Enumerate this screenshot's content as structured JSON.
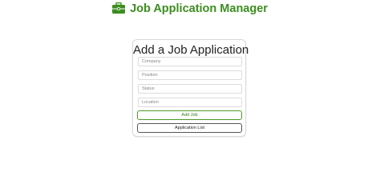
{
  "header": {
    "title": "Job Application Manager",
    "icon": "briefcase-icon",
    "accent_color": "#3c8e1f"
  },
  "form": {
    "title": "Add a Job Application",
    "fields": {
      "company": {
        "placeholder": "Company",
        "value": ""
      },
      "position": {
        "placeholder": "Position",
        "value": ""
      },
      "status": {
        "placeholder": "Status",
        "value": ""
      },
      "location": {
        "placeholder": "Location",
        "value": ""
      }
    },
    "add_button_label": "Add Job",
    "list_button_label": "Application List"
  }
}
